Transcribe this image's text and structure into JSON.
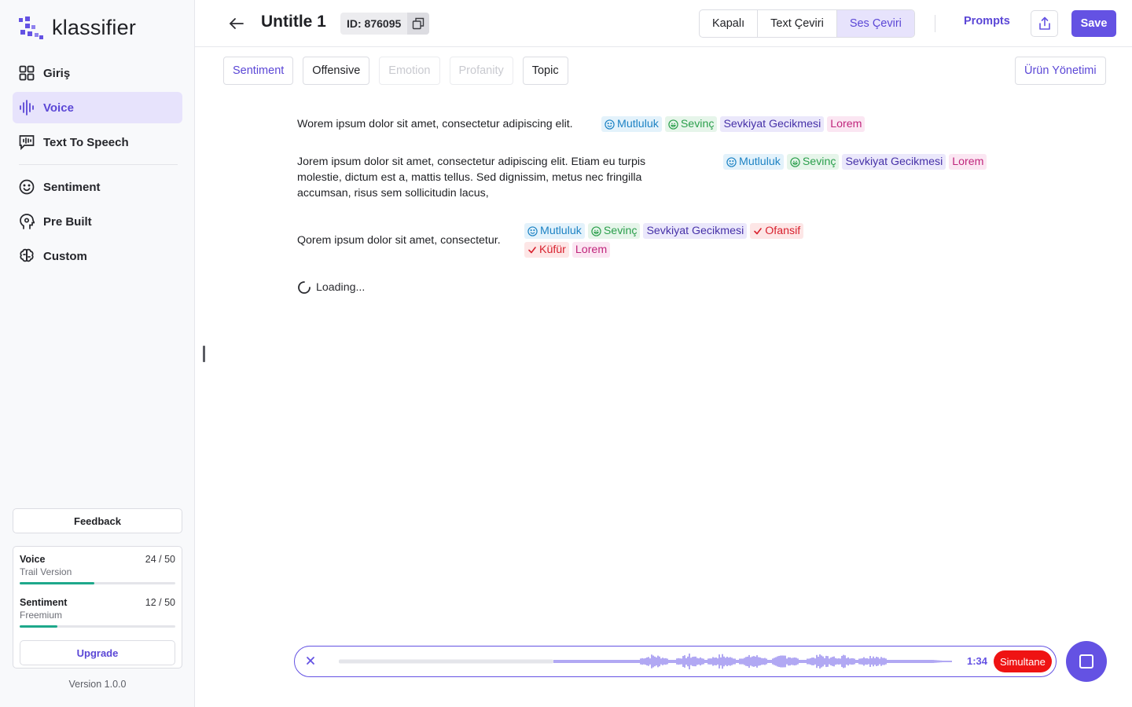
{
  "brand": {
    "name": "klassifier",
    "accent": "#6452e3"
  },
  "sidebar": {
    "nav": [
      {
        "label": "Giriş",
        "icon": "grid-icon"
      },
      {
        "label": "Voice",
        "icon": "audio-wave-icon",
        "active": true
      },
      {
        "label": "Text To Speech",
        "icon": "speech-bubble-wave-icon"
      }
    ],
    "nav2": [
      {
        "label": "Sentiment",
        "icon": "smile-icon"
      },
      {
        "label": "Pre Built",
        "icon": "head-gear-icon"
      },
      {
        "label": "Custom",
        "icon": "brain-icon"
      }
    ],
    "feedback_label": "Feedback",
    "usage": [
      {
        "name": "Voice",
        "plan": "Trail Version",
        "count": "24 / 50",
        "fraction": 0.48
      },
      {
        "name": "Sentiment",
        "plan": "Freemium",
        "count": "12 / 50",
        "fraction": 0.24
      }
    ],
    "upgrade_label": "Upgrade",
    "version": "Version 1.0.0"
  },
  "header": {
    "title": "Untitle 1",
    "id_label": "ID: 876095",
    "modes": [
      "Kapalı",
      "Text Çeviri",
      "Ses Çeviri"
    ],
    "active_mode": "Ses Çeviri",
    "prompts_label": "Prompts",
    "save_label": "Save"
  },
  "filters": {
    "tabs": [
      {
        "label": "Sentiment",
        "state": "active"
      },
      {
        "label": "Offensive",
        "state": "normal"
      },
      {
        "label": "Emotion",
        "state": "disabled"
      },
      {
        "label": "Profanity",
        "state": "disabled"
      },
      {
        "label": "Topic",
        "state": "normal"
      }
    ],
    "urun_label": "Ürün Yönetimi"
  },
  "transcript": {
    "segments": [
      {
        "text": "Worem ipsum dolor sit amet, consectetur adipiscing elit.",
        "tags": [
          {
            "label": "Mutluluk",
            "type": "mutluluk",
            "icon": "smile-icon"
          },
          {
            "label": "Sevinç",
            "type": "sevinc",
            "icon": "grin-icon"
          },
          {
            "label": "Sevkiyat Gecikmesi",
            "type": "sevkiyat"
          },
          {
            "label": "Lorem",
            "type": "lorem"
          }
        ]
      },
      {
        "text": "Jorem ipsum dolor sit amet, consectetur adipiscing elit. Etiam eu turpis molestie, dictum est a, mattis tellus. Sed dignissim, metus nec fringilla accumsan, risus sem sollicitudin lacus,",
        "tags": [
          {
            "label": "Mutluluk",
            "type": "mutluluk",
            "icon": "smile-icon"
          },
          {
            "label": "Sevinç",
            "type": "sevinc",
            "icon": "grin-icon"
          },
          {
            "label": "Sevkiyat Gecikmesi",
            "type": "sevkiyat"
          },
          {
            "label": "Lorem",
            "type": "lorem"
          }
        ]
      },
      {
        "text": "Qorem ipsum dolor sit amet, consectetur.",
        "tags": [
          {
            "label": "Mutluluk",
            "type": "mutluluk",
            "icon": "smile-icon"
          },
          {
            "label": "Sevinç",
            "type": "sevinc",
            "icon": "grin-icon"
          },
          {
            "label": "Sevkiyat Gecikmesi",
            "type": "sevkiyat"
          },
          {
            "label": "Ofansif",
            "type": "ofansif",
            "icon": "check-icon"
          },
          {
            "label": "Küfür",
            "type": "ofansif",
            "icon": "check-icon"
          },
          {
            "label": "Lorem",
            "type": "lorem"
          }
        ]
      }
    ],
    "loading_label": "Loading..."
  },
  "player": {
    "time": "1:34",
    "mode_label": "Simultane",
    "progress": 0.35
  }
}
